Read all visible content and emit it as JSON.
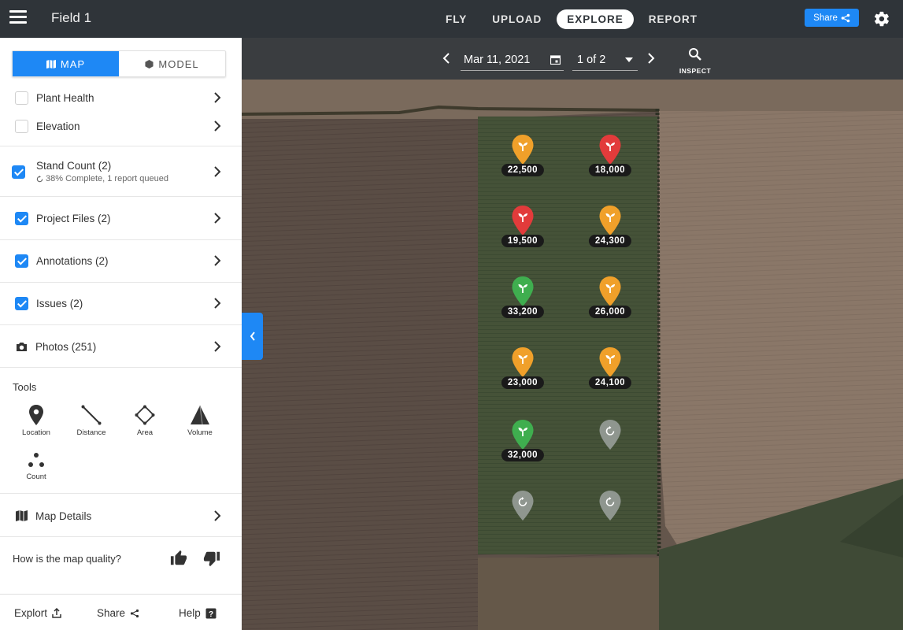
{
  "topbar": {
    "title": "Field 1",
    "tabs": [
      {
        "label": "FLY"
      },
      {
        "label": "UPLOAD"
      },
      {
        "label": "EXPLORE",
        "active": true
      },
      {
        "label": "REPORT"
      }
    ],
    "share_label": "Share",
    "accent_color": "#1e88f5"
  },
  "sidebar": {
    "mode": {
      "map_label": "MAP",
      "model_label": "MODEL"
    },
    "layers": {
      "plant_health": "Plant Health",
      "elevation": "Elevation",
      "stand_count": "Stand Count (2)",
      "stand_count_status": "38% Complete, 1 report queued",
      "project_files": "Project Files (2)",
      "annotations": "Annotations (2)",
      "issues": "Issues (2)",
      "photos": "Photos (251)"
    },
    "tools": {
      "title": "Tools",
      "location": "Location",
      "distance": "Distance",
      "area": "Area",
      "volume": "Volume",
      "count": "Count"
    },
    "map_details": "Map Details",
    "quality_question": "How is the map quality?",
    "footer": {
      "export": "Explort",
      "share": "Share",
      "help": "Help"
    }
  },
  "map_toolbar": {
    "date": "Mar 11, 2021",
    "page": "1 of 2",
    "inspect": "INSPECT"
  },
  "stand_counts": [
    {
      "value": "22,500",
      "status": "orange"
    },
    {
      "value": "18,000",
      "status": "red"
    },
    {
      "value": "19,500",
      "status": "red"
    },
    {
      "value": "24,300",
      "status": "orange"
    },
    {
      "value": "33,200",
      "status": "green"
    },
    {
      "value": "26,000",
      "status": "orange"
    },
    {
      "value": "23,000",
      "status": "orange"
    },
    {
      "value": "24,100",
      "status": "orange"
    },
    {
      "value": "32,000",
      "status": "green"
    },
    {
      "value": "",
      "status": "pending"
    },
    {
      "value": "",
      "status": "pending"
    },
    {
      "value": "",
      "status": "pending"
    }
  ],
  "status_colors": {
    "orange": "#f0a02a",
    "red": "#e23b3b",
    "green": "#3fae4f",
    "pending": "#8f968f"
  }
}
